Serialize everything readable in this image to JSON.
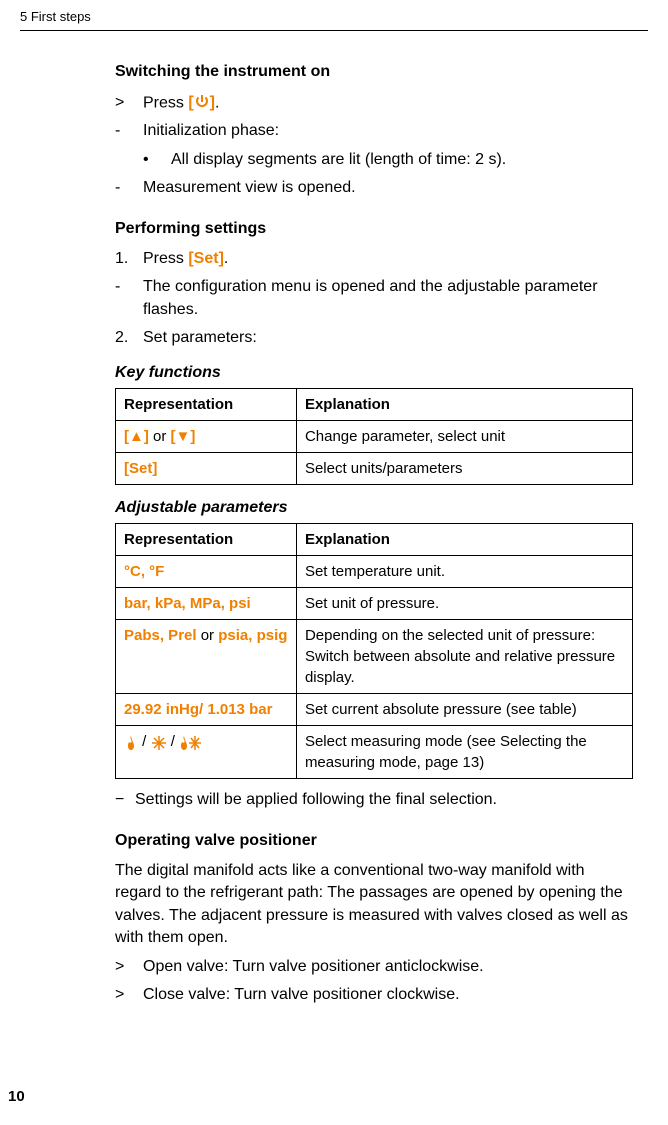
{
  "header": {
    "chapter": "5 First steps"
  },
  "section1": {
    "title": "Switching the instrument on",
    "items": [
      {
        "marker": ">",
        "prefix": "Press ",
        "orange_open": "[",
        "orange_close": "]",
        "suffix": "."
      },
      {
        "marker": "-",
        "text": "Initialization phase:"
      },
      {
        "marker": "-",
        "text": "Measurement view is opened."
      }
    ],
    "sub_item": {
      "marker": "•",
      "text": "All display segments are lit (length of time: 2 s)."
    }
  },
  "section2": {
    "title": "Performing settings",
    "items": [
      {
        "marker": "1.",
        "prefix": "Press ",
        "orange": "[Set]",
        "suffix": "."
      },
      {
        "marker": "-",
        "text": "The configuration menu is opened and the adjustable parameter flashes."
      },
      {
        "marker": "2.",
        "text": "Set parameters:"
      }
    ]
  },
  "table1": {
    "caption": "Key functions",
    "headers": {
      "rep": "Representation",
      "exp": "Explanation"
    },
    "rows": [
      {
        "rep_parts": {
          "a": "[▲]",
          "mid": " or ",
          "b": "[▼]"
        },
        "exp": "Change parameter, select unit"
      },
      {
        "rep_orange": "[Set]",
        "exp": "Select units/parameters"
      }
    ]
  },
  "table2": {
    "caption": "Adjustable parameters",
    "headers": {
      "rep": "Representation",
      "exp": "Explanation"
    },
    "rows": [
      {
        "rep_orange": "°C, °F",
        "exp": "Set temperature unit."
      },
      {
        "rep_orange": "bar, kPa, MPa, psi",
        "exp": "Set unit of pressure."
      },
      {
        "rep_parts": {
          "a": "Pabs, Prel",
          "mid": " or ",
          "b": "psia, psig"
        },
        "exp": "Depending on the selected unit of pressure: Switch between absolute and relative pressure display."
      },
      {
        "rep_orange": "29.92 inHg/ 1.013 bar",
        "exp": "Set current absolute pressure (see table)"
      },
      {
        "icons": true,
        "exp": "Select measuring mode (see Selecting the measuring mode, page 13)"
      }
    ]
  },
  "note": "Settings will be applied following the final selection.",
  "section3": {
    "title": "Operating valve positioner",
    "para": "The digital manifold acts like a conventional two-way manifold with regard to the refrigerant path: The passages are opened by opening the valves. The adjacent pressure is measured with valves closed as well as with them open.",
    "items": [
      {
        "marker": ">",
        "text": "Open valve: Turn valve positioner anticlockwise."
      },
      {
        "marker": ">",
        "text": "Close valve: Turn valve positioner clockwise."
      }
    ]
  },
  "page_number": "10"
}
